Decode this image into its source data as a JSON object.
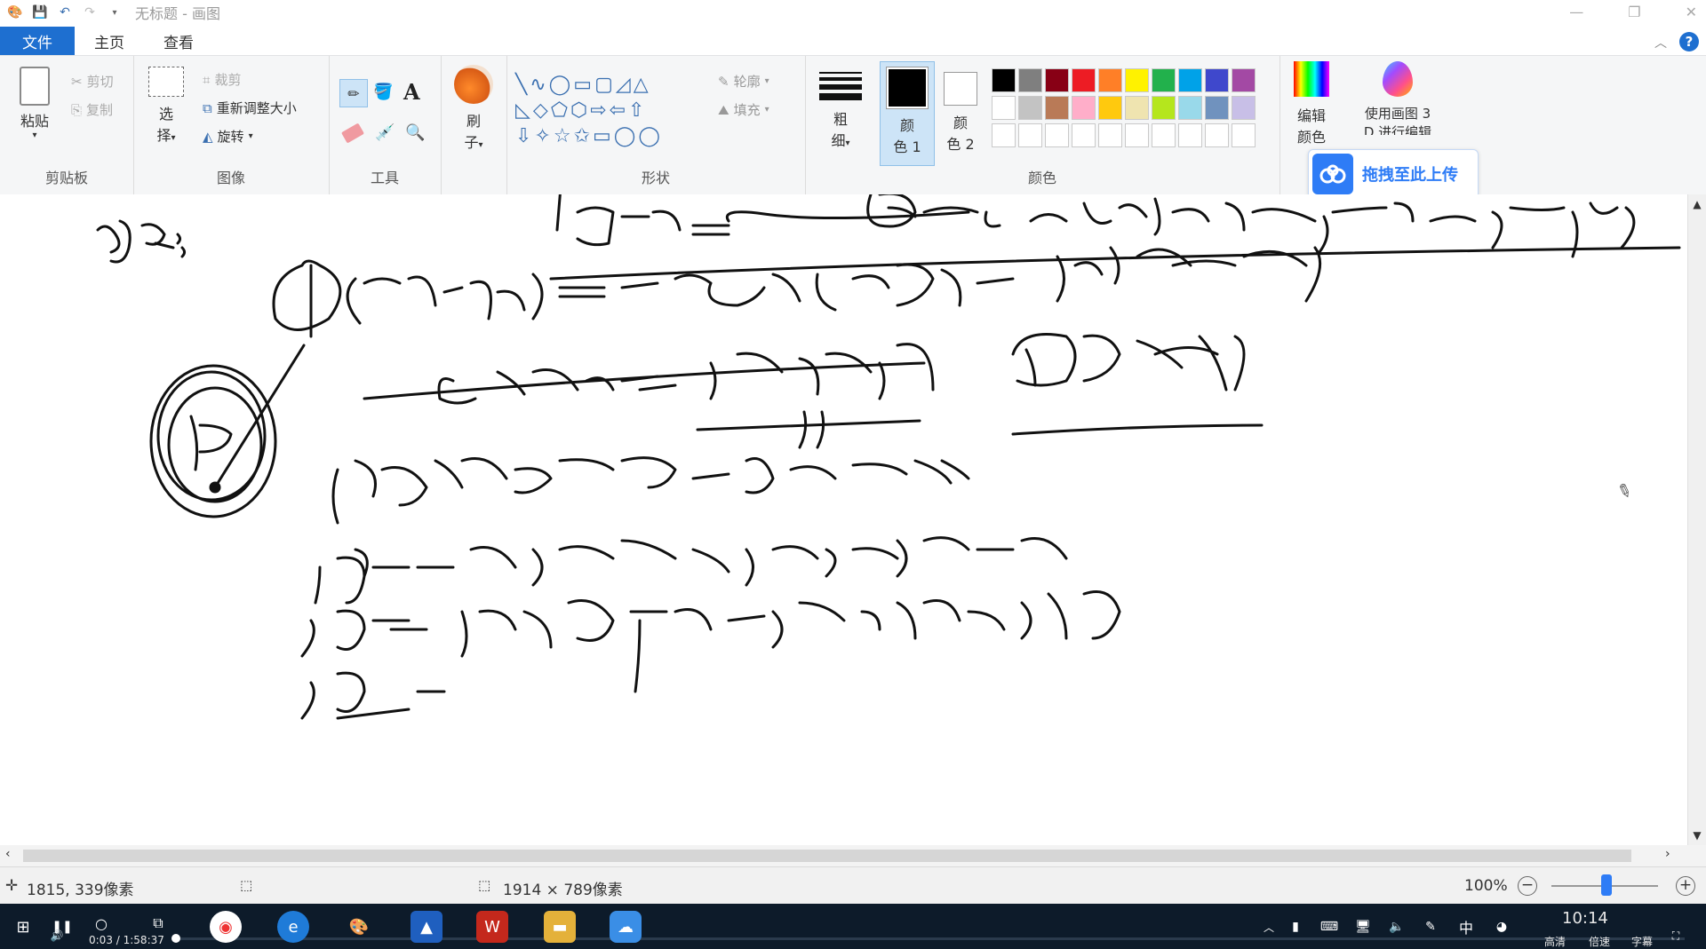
{
  "window": {
    "title": "无标题 - 画图"
  },
  "tabs": [
    "文件",
    "主页",
    "查看"
  ],
  "ribbon": {
    "clipboard": {
      "paste": "粘贴",
      "cut": "剪切",
      "copy": "复制",
      "label": "剪贴板"
    },
    "image": {
      "select_1": "选",
      "select_2": "择",
      "crop": "裁剪",
      "resize": "重新调整大小",
      "rotate": "旋转",
      "label": "图像"
    },
    "tools": {
      "label": "工具"
    },
    "brush": {
      "line1": "刷",
      "line2": "子"
    },
    "shapes": {
      "outline": "轮廓",
      "fill": "填充",
      "label": "形状"
    },
    "size": {
      "line1": "粗",
      "line2": "细"
    },
    "color1": {
      "line1": "颜",
      "line2": "色 1"
    },
    "color2": {
      "line1": "颜",
      "line2": "色 2"
    },
    "colors": {
      "label": "颜色"
    },
    "edit_colors": {
      "line1": "编辑",
      "line2": "颜色"
    },
    "paint3d": {
      "line1": "使用画图 3",
      "line2": "D 进行编辑"
    }
  },
  "palette": {
    "row1": [
      "#000000",
      "#7f7f7f",
      "#880015",
      "#ed1c24",
      "#ff7f27",
      "#fff200",
      "#22b14c",
      "#00a2e8",
      "#3f48cc",
      "#a349a4"
    ],
    "row2": [
      "#ffffff",
      "#c3c3c3",
      "#b97a57",
      "#ffaec9",
      "#ffc90e",
      "#efe4b0",
      "#b5e61d",
      "#99d9ea",
      "#7092be",
      "#c8bfe7"
    ],
    "row3": [
      "#ffffff",
      "#ffffff",
      "#ffffff",
      "#ffffff",
      "#ffffff",
      "#ffffff",
      "#ffffff",
      "#ffffff",
      "#ffffff",
      "#ffffff"
    ]
  },
  "upload_overlay": {
    "label": "拖拽至此上传"
  },
  "status": {
    "cursor_pos": "1815, 339像素",
    "canvas_size": "1914 × 789像素",
    "zoom": "100%"
  },
  "taskbar": {
    "video_time": "0:03 / 1:58:37",
    "clock": "10:14",
    "hd": "高清",
    "speed": "倍速",
    "subtitle": "字幕"
  }
}
